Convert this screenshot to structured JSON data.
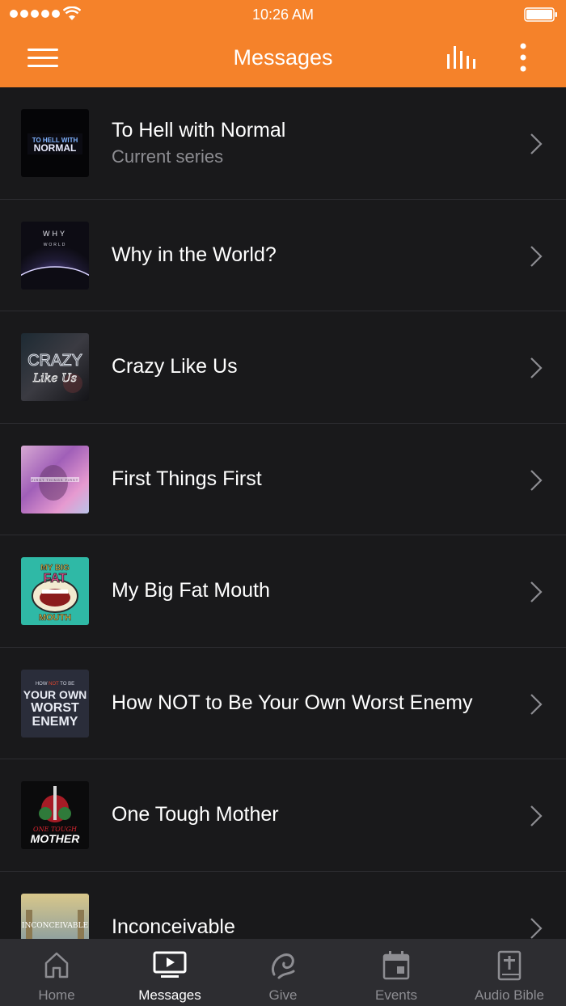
{
  "status_bar": {
    "time": "10:26 AM"
  },
  "header": {
    "title": "Messages"
  },
  "series": [
    {
      "title": "To Hell with Normal",
      "subtitle": "Current series",
      "art_text": "TO HELL WITH NORMAL"
    },
    {
      "title": "Why in the World?",
      "art_text": "WHY in the WORLD"
    },
    {
      "title": "Crazy Like Us",
      "art_text": "CRAZY Like Us"
    },
    {
      "title": "First Things First",
      "art_text": "FIRST THINGS FIRST"
    },
    {
      "title": "My Big Fat Mouth",
      "art_text": "MY BIG FAT MOUTH"
    },
    {
      "title": "How NOT to Be Your Own Worst Enemy",
      "art_text": "HOW NOT TO BE YOUR OWN WORST ENEMY"
    },
    {
      "title": "One Tough Mother",
      "art_text": "ONE TOUGH MOTHER"
    },
    {
      "title": "Inconceivable",
      "art_text": "INCONCEIVABLE"
    }
  ],
  "tabs": [
    {
      "label": "Home",
      "icon": "home-icon"
    },
    {
      "label": "Messages",
      "icon": "tv-play-icon",
      "active": true
    },
    {
      "label": "Give",
      "icon": "give-icon"
    },
    {
      "label": "Events",
      "icon": "calendar-icon"
    },
    {
      "label": "Audio Bible",
      "icon": "bible-icon"
    }
  ],
  "colors": {
    "accent": "#f5822a",
    "background": "#19191b",
    "divider": "#2d2d31",
    "tab_bar": "#2d2d31",
    "muted_text": "#8d8d92"
  }
}
